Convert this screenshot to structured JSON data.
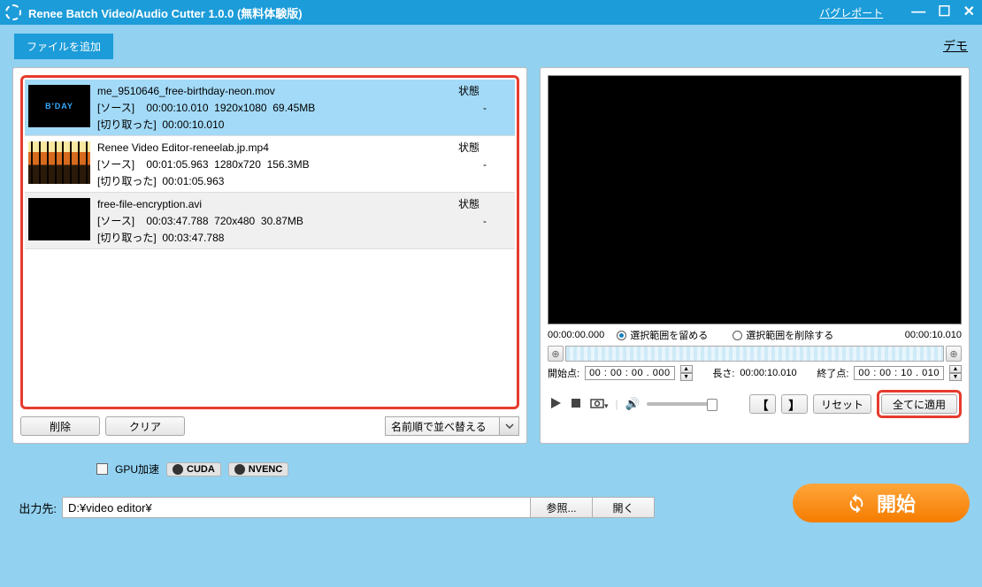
{
  "titlebar": {
    "title": "Renee Batch Video/Audio Cutter 1.0.0 (無料体験版)",
    "bugreport": "バグレポート"
  },
  "toolbar": {
    "add_file": "ファイルを追加",
    "demo": "デモ"
  },
  "files": [
    {
      "name": "me_9510646_free-birthday-neon.mov",
      "state_label": "状態",
      "state": "-",
      "source_label": "[ソース]",
      "source_time": "00:00:10.010",
      "resolution": "1920x1080",
      "size": "69.45MB",
      "cut_label": "[切り取った]",
      "cut_time": "00:00:10.010"
    },
    {
      "name": "Renee Video Editor-reneelab.jp.mp4",
      "state_label": "状態",
      "state": "-",
      "source_label": "[ソース]",
      "source_time": "00:01:05.963",
      "resolution": "1280x720",
      "size": "156.3MB",
      "cut_label": "[切り取った]",
      "cut_time": "00:01:05.963"
    },
    {
      "name": "free-file-encryption.avi",
      "state_label": "状態",
      "state": "-",
      "source_label": "[ソース]",
      "source_time": "00:03:47.788",
      "resolution": "720x480",
      "size": "30.87MB",
      "cut_label": "[切り取った]",
      "cut_time": "00:03:47.788"
    }
  ],
  "left_bottom": {
    "delete": "削除",
    "clear": "クリア",
    "sort": "名前順で並べ替える"
  },
  "player": {
    "pos_time": "00:00:00.000",
    "keep_range": "選択範囲を留める",
    "delete_range": "選択範囲を削除する",
    "end_time": "00:00:10.010",
    "start_label": "開始点:",
    "start_val": "00 : 00 : 00 . 000",
    "length_label": "長さ:",
    "length_val": "00:00:10.010",
    "finish_label": "終了点:",
    "finish_val": "00 : 00 : 10 . 010",
    "reset": "リセット",
    "apply_all": "全てに適用"
  },
  "bottom": {
    "gpu_label": "GPU加速",
    "cuda": "CUDA",
    "nvenc": "NVENC",
    "output_label": "出力先:",
    "output_path": "D:¥video editor¥",
    "browse": "参照...",
    "open": "開く",
    "start": "開始"
  }
}
